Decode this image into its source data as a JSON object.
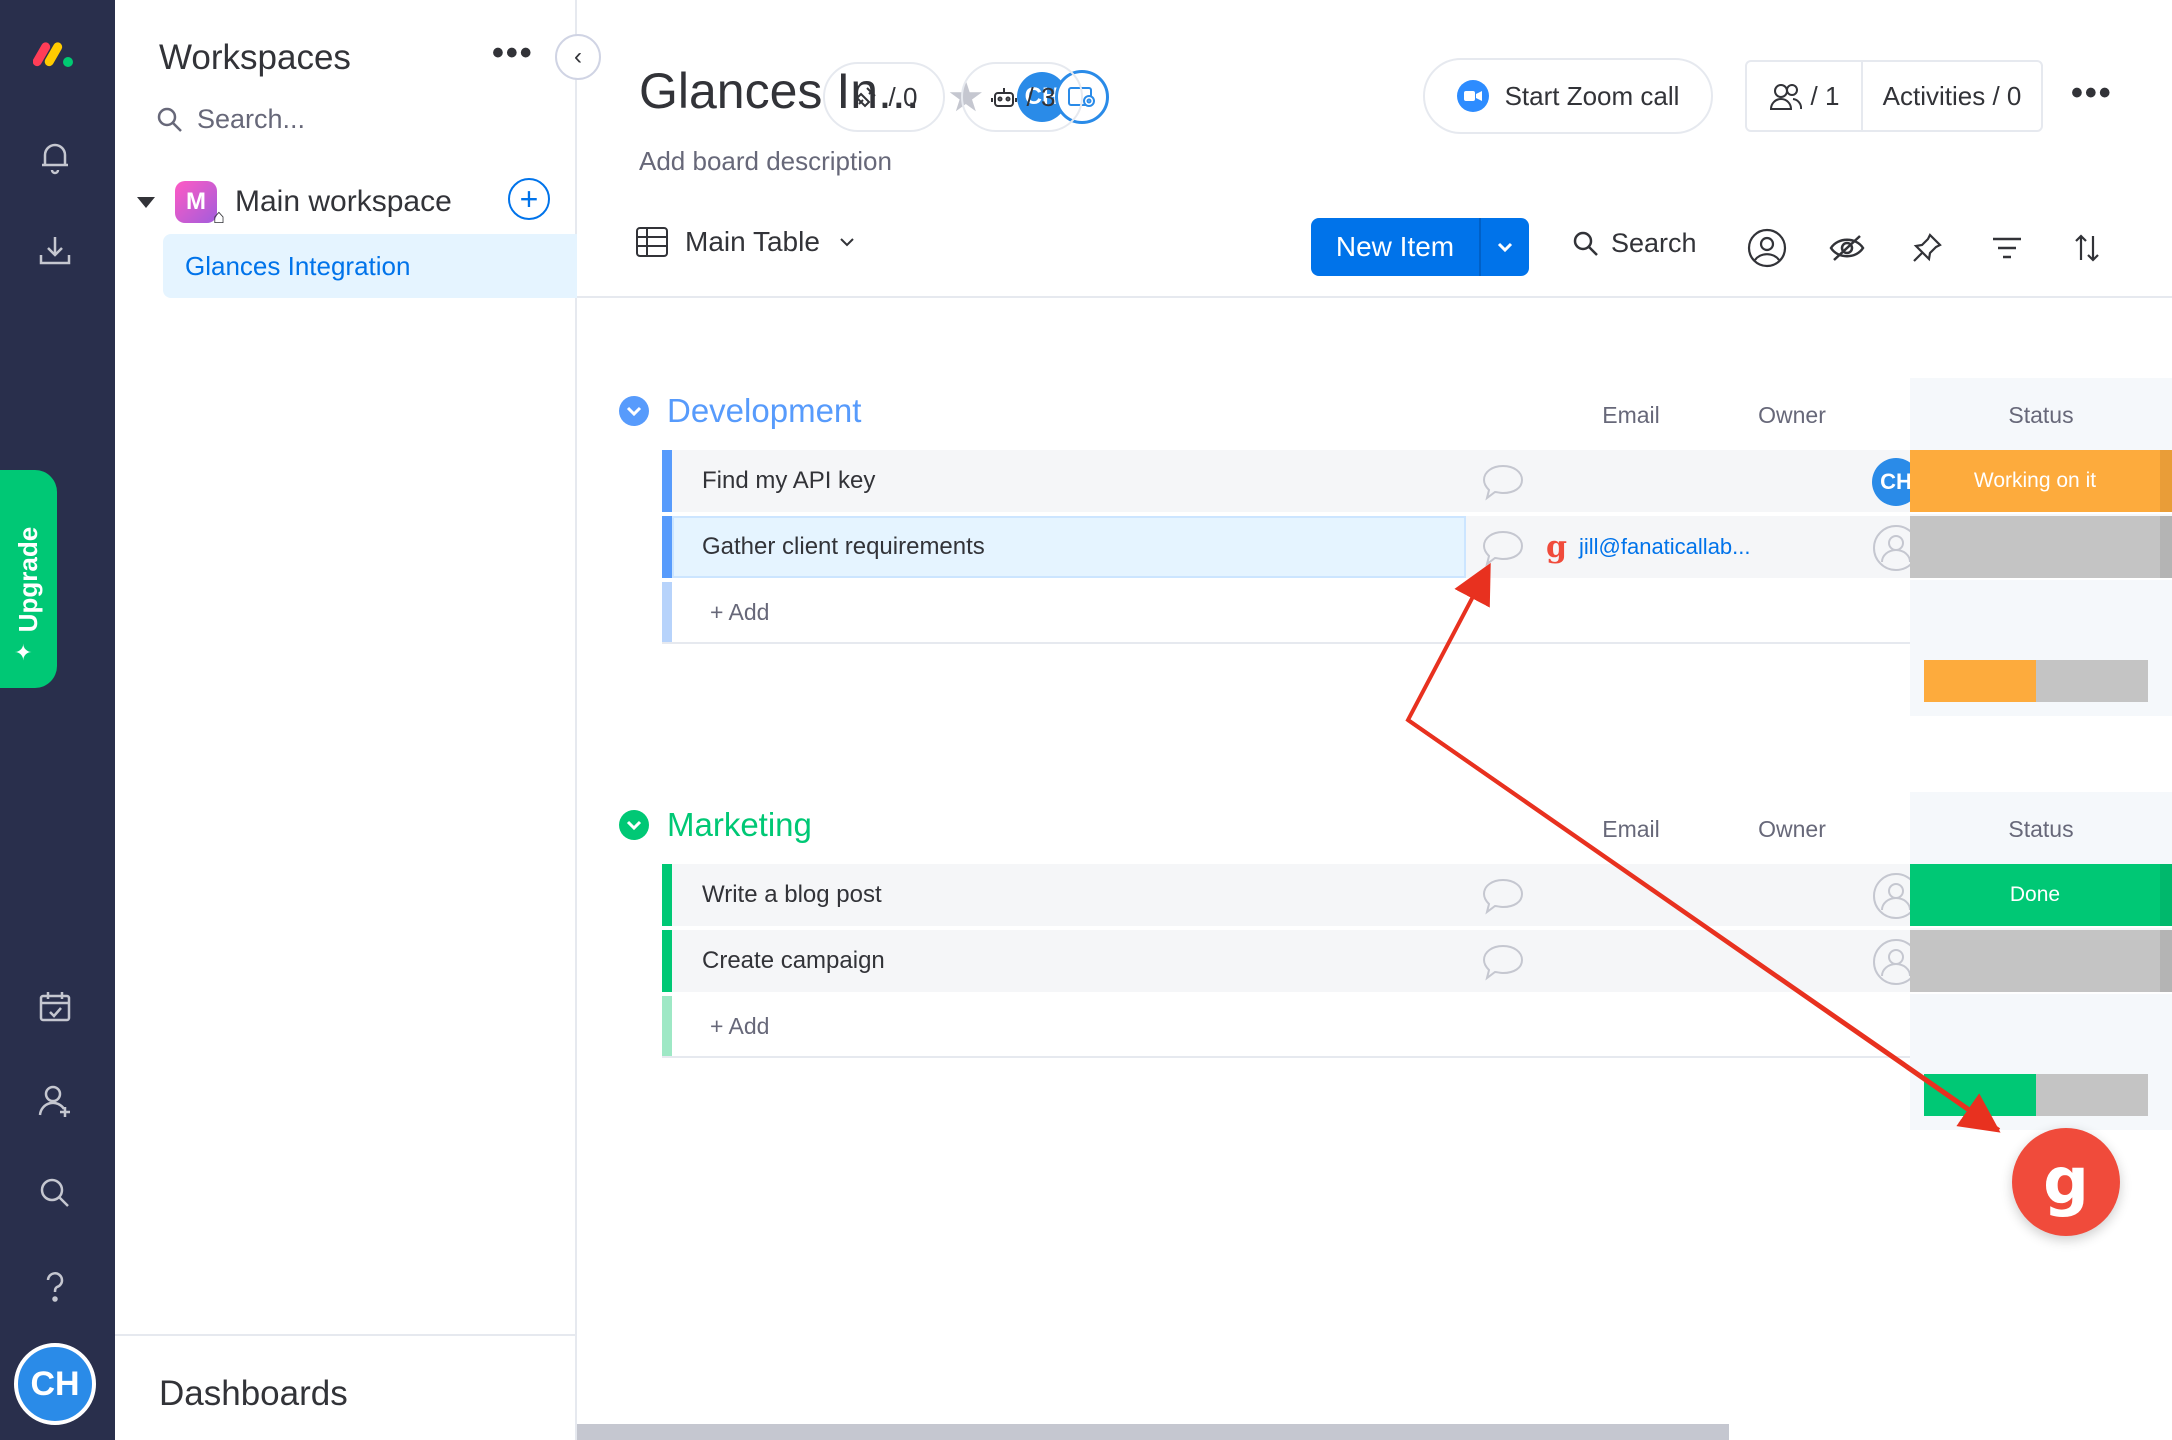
{
  "rail": {
    "logo": "monday-logo",
    "upgrade_label": "Upgrade",
    "user_initials": "CH"
  },
  "sidebar": {
    "title": "Workspaces",
    "search_placeholder": "Search...",
    "workspace": {
      "badge": "M",
      "name": "Main workspace"
    },
    "boards": [
      {
        "label": "Glances Integration",
        "active": true
      }
    ],
    "dashboards_label": "Dashboards"
  },
  "board": {
    "title": "Glances In...",
    "description": "Add board description",
    "owner_initials": "CH",
    "integrations_count": "/ 0",
    "automations_count": "/ 3",
    "zoom_label": "Start Zoom call",
    "members_count": "/ 1",
    "activities_label": "Activities / 0"
  },
  "toolbar": {
    "view_label": "Main Table",
    "new_item_label": "New Item",
    "search_label": "Search"
  },
  "columns": {
    "email": "Email",
    "owner": "Owner",
    "status": "Status"
  },
  "groups": [
    {
      "name": "Development",
      "color": "#579bfc",
      "items": [
        {
          "name": "Find my API key",
          "email": "",
          "owner": "CH",
          "status": "Working on it",
          "status_color": "#fdab3d"
        },
        {
          "name": "Gather client requirements",
          "email": "jill@fanaticallab...",
          "owner": "",
          "status": "",
          "status_color": "#c4c4c4"
        }
      ],
      "add_label": "+ Add",
      "summary": {
        "filled_fraction": 0.5,
        "color": "#fdab3d"
      }
    },
    {
      "name": "Marketing",
      "color": "#00c875",
      "items": [
        {
          "name": "Write a blog post",
          "email": "",
          "owner": "",
          "status": "Done",
          "status_color": "#00c875"
        },
        {
          "name": "Create campaign",
          "email": "",
          "owner": "",
          "status": "",
          "status_color": "#c4c4c4"
        }
      ],
      "add_label": "+ Add",
      "summary": {
        "filled_fraction": 0.5,
        "color": "#00c875"
      }
    }
  ],
  "fab": {
    "glyph": "g",
    "color": "#f04b3b"
  },
  "annotation": {
    "color": "#e8311f"
  }
}
